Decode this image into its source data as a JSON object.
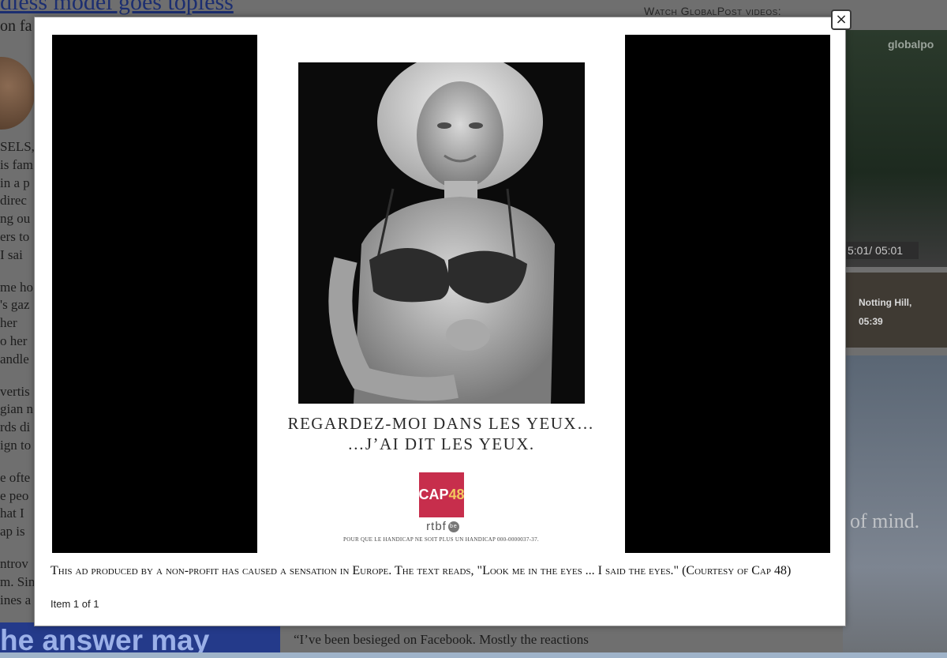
{
  "background_page": {
    "headline_fragment": "dless model goes topless",
    "subline_fragment": "on fa",
    "body_fragments": [
      "SELS,",
      "is fam",
      "in a p",
      "direc",
      "ng ou",
      "ers to",
      "I sai",
      "",
      "me ho",
      "'s gaz",
      "her",
      "o her",
      "andle",
      "",
      "vertis",
      "gian n",
      "rds di",
      "ign to",
      "",
      "e ofte",
      "e peo",
      "hat I",
      "ap is",
      "",
      "ntrov",
      "m. Sin",
      "ines a"
    ],
    "answer_banner_fragment": "he answer may",
    "quote_fragment": "“I’ve been besieged on Facebook. Mostly the reactions",
    "video_section_label": "Watch GlobalPost videos:",
    "video_brand": "globalpo",
    "video_time": "5:01/ 05:01",
    "thumb_title": "Notting Hill,",
    "thumb_duration": "05:39",
    "ad_text_fragment": "of mind."
  },
  "lightbox": {
    "close_label": "×",
    "poster": {
      "headline_line1": "REGARDEZ-MOI DANS LES YEUX…",
      "headline_line2": "…J’AI DIT LES YEUX.",
      "logo_text": "CAP",
      "logo_number": "48",
      "broadcaster": "rtbf",
      "broadcaster_badge": "be",
      "tagline": "POUR QUE LE HANDICAP NE SOIT PLUS UN HANDICAP  000-0000037-37."
    },
    "caption": "This ad produced by a non-profit has caused a sensation in Europe. The text reads, \"Look me in the eyes ... I said the eyes.\" (Courtesy of Cap 48)",
    "counter": "Item 1 of 1"
  },
  "colors": {
    "overlay": "#6f6f6f",
    "cap_logo": "#c72e4c",
    "cap_number": "#f4c75e",
    "banner": "#243a8a"
  }
}
